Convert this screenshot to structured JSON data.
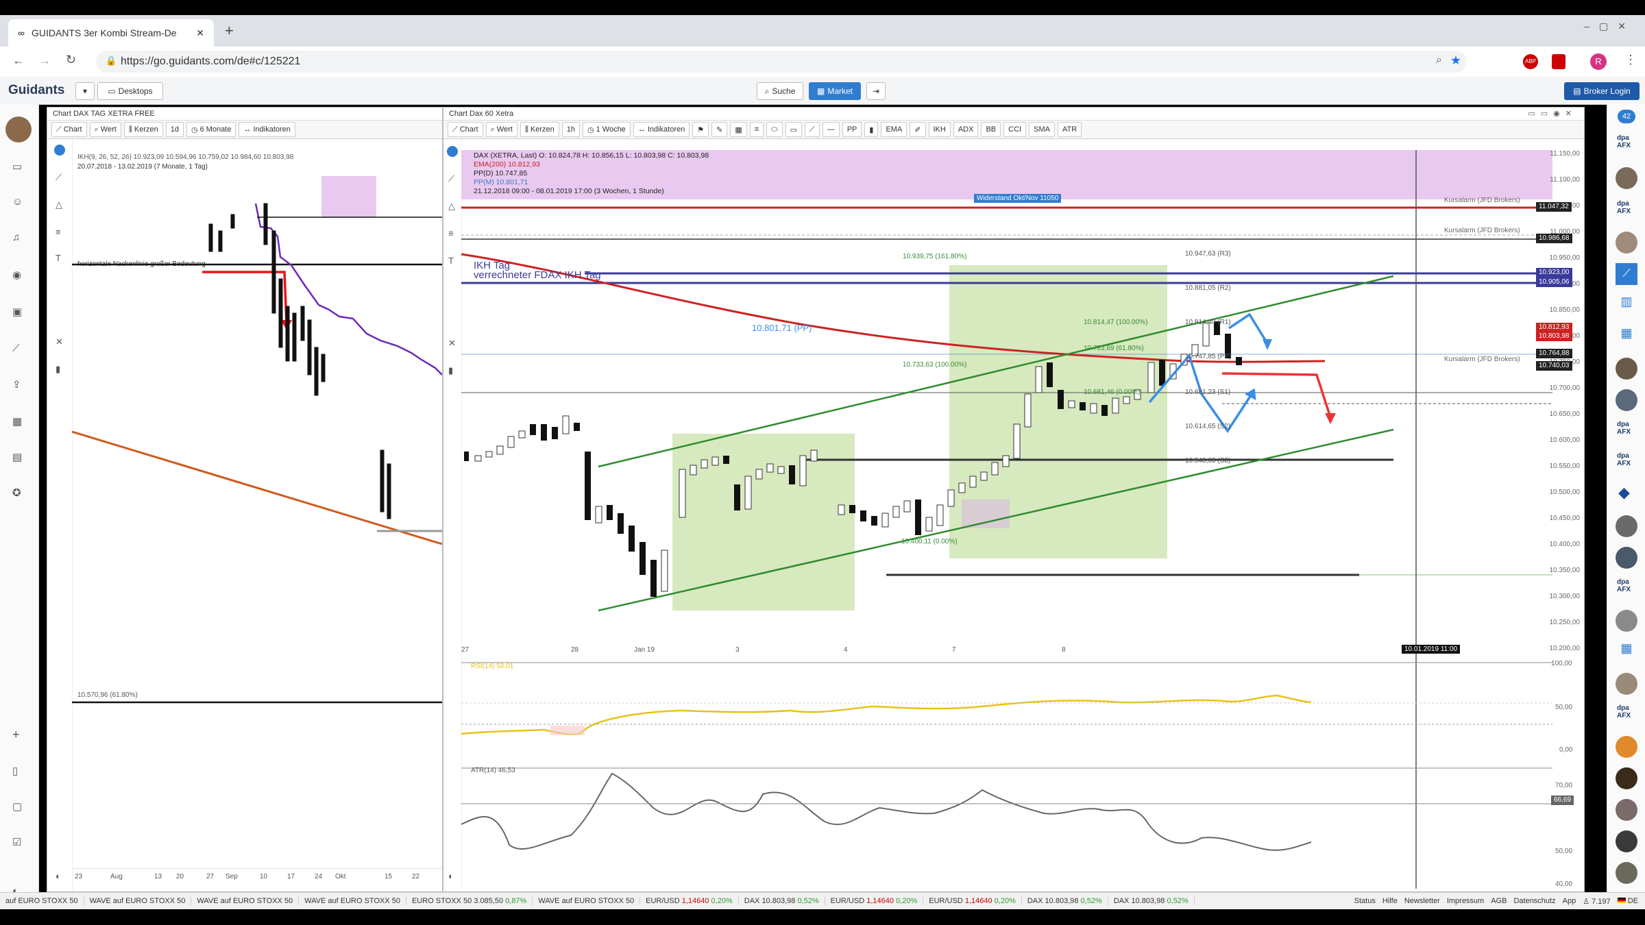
{
  "browser": {
    "tab_title": "GUIDANTS 3er Kombi Stream-De",
    "url": "https://go.guidants.com/de#c/125221",
    "profile_initial": "R"
  },
  "app": {
    "logo": "Guidants",
    "desktops_label": "Desktops",
    "search_label": "Suche",
    "market_label": "Market",
    "broker_login": "Broker Login",
    "notif_count": "42"
  },
  "left_panel": {
    "title": "Chart DAX TAG XETRA FREE",
    "toolbar": [
      "Chart",
      "Wert",
      "Kerzen",
      "1d",
      "6 Monate",
      "Indikatoren"
    ],
    "legend": [
      "IKH(9, 26, 52, 26) 10.923,09  10.594,96  10.759,02  10.984,60  10.803,98",
      "20.07.2018 - 13.02.2019   (7 Monate, 1 Tag)"
    ],
    "annotation": "horizontale Nackenlinie großer Bedeutung",
    "fib_label": "10.570,96 (61.80%)",
    "x_ticks": [
      "23",
      "Aug",
      "13",
      "20",
      "27",
      "Sep",
      "10",
      "17",
      "24",
      "Okt",
      "15",
      "22"
    ]
  },
  "main_panel": {
    "title": "Chart Dax 60 Xetra",
    "toolbar": [
      "Chart",
      "Wert",
      "Kerzen",
      "1h",
      "1 Woche",
      "Indikatoren",
      "PP",
      "EMA",
      "IKH",
      "ADX",
      "BB",
      "CCI",
      "SMA",
      "ATR"
    ],
    "legend": [
      "DAX (XETRA, Last)  O: 10.824,78  H: 10.856,15  L: 10.803,98  C: 10.803,98",
      "EMA(200)  10.812,93",
      "PP(D)  10.747,85",
      "PP(M)  10.801,71",
      "21.12.2018 09:00 - 08.01.2019 17:00   (3 Wochen, 1 Stunde)"
    ],
    "resistance_label": "Widerstand Okt/Nov 11050",
    "ikh_labels": [
      "IKH Tag",
      "verrechneter FDAX IKH Tag"
    ],
    "pp_label": "10.801,71 (PP)",
    "level_labels": [
      {
        "text": "10.939,75 (161.80%)"
      },
      {
        "text": "10.947,63 (R3)"
      },
      {
        "text": "10.881,05 (R2)"
      },
      {
        "text": "10.814,47 (100.00%)"
      },
      {
        "text": "10.814,40 (R1)"
      },
      {
        "text": "10.783,69 (61.80%)"
      },
      {
        "text": "10.747,85 (PP)"
      },
      {
        "text": "10.733,63 (100.00%)"
      },
      {
        "text": "10.681,23 (S1)"
      },
      {
        "text": "10.681,46 (0.00%)"
      },
      {
        "text": "10.614,65 (S2)"
      },
      {
        "text": "10.548,03 (S3)"
      },
      {
        "text": "10.400,11 (0.00%)"
      }
    ],
    "alarm_labels": [
      "Kursalarm (JFD Brokers)",
      "Kursalarm (JFD Brokers)",
      "Kursalarm (JFD Brokers)"
    ],
    "y_ticks": [
      "11.150,00",
      "11.100,00",
      "11.050,00",
      "11.000,00",
      "10.950,00",
      "10.900,00",
      "10.850,00",
      "10.800,00",
      "10.750,00",
      "10.700,00",
      "10.650,00",
      "10.600,00",
      "10.550,00",
      "10.500,00",
      "10.450,00",
      "10.400,00",
      "10.350,00",
      "10.300,00",
      "10.250,00",
      "10.200,00"
    ],
    "price_tags": [
      {
        "text": "11.047,32",
        "color": "#222222"
      },
      {
        "text": "10.986,68",
        "color": "#222222"
      },
      {
        "text": "10.923,00",
        "color": "#3a3a9a"
      },
      {
        "text": "10.905,06",
        "color": "#3a3a9a"
      },
      {
        "text": "10.812,93",
        "color": "#cc2222"
      },
      {
        "text": "10.803,98",
        "color": "#cc2222"
      },
      {
        "text": "10.764,88",
        "color": "#222222"
      },
      {
        "text": "10.740,03",
        "color": "#222222"
      }
    ],
    "x_ticks": [
      "27",
      "28",
      "Jan 19",
      "3",
      "4",
      "7",
      "8"
    ],
    "crosshair_time": "10.01.2019 11:00",
    "rsi_label": "RSI(14)  58,01",
    "rsi_ticks": [
      "100,00",
      "50,00",
      "0,00"
    ],
    "atr_label": "ATR(14)  46,53",
    "atr_ticks": [
      "70,00",
      "66,69",
      "50,00",
      "40,00"
    ]
  },
  "status_bar": {
    "items": [
      {
        "name": "auf EURO STOXX 50",
        "val": "",
        "chg": ""
      },
      {
        "name": "WAVE auf EURO STOXX 50",
        "val": "",
        "chg": ""
      },
      {
        "name": "WAVE auf EURO STOXX 50",
        "val": "",
        "chg": ""
      },
      {
        "name": "WAVE auf EURO STOXX 50",
        "val": "",
        "chg": ""
      },
      {
        "name": "EURO STOXX 50",
        "val": "3.085,50",
        "chg": "0,87%"
      },
      {
        "name": "WAVE auf EURO STOXX 50",
        "val": "",
        "chg": ""
      },
      {
        "name": "EUR/USD",
        "val": "1,14640",
        "chg": "0,20%"
      },
      {
        "name": "DAX",
        "val": "10.803,98",
        "chg": "0,52%"
      },
      {
        "name": "EUR/USD",
        "val": "1,14640",
        "chg": "0,20%"
      },
      {
        "name": "EUR/USD",
        "val": "1,14640",
        "chg": "0,20%"
      },
      {
        "name": "DAX",
        "val": "10.803,98",
        "chg": "0,52%"
      },
      {
        "name": "DAX",
        "val": "10.803,98",
        "chg": "0,52%"
      }
    ],
    "links": [
      "Status",
      "Hilfe",
      "Newsletter",
      "Impressum",
      "AGB",
      "Datenschutz",
      "App"
    ],
    "users": "7.197",
    "lang": "DE"
  }
}
